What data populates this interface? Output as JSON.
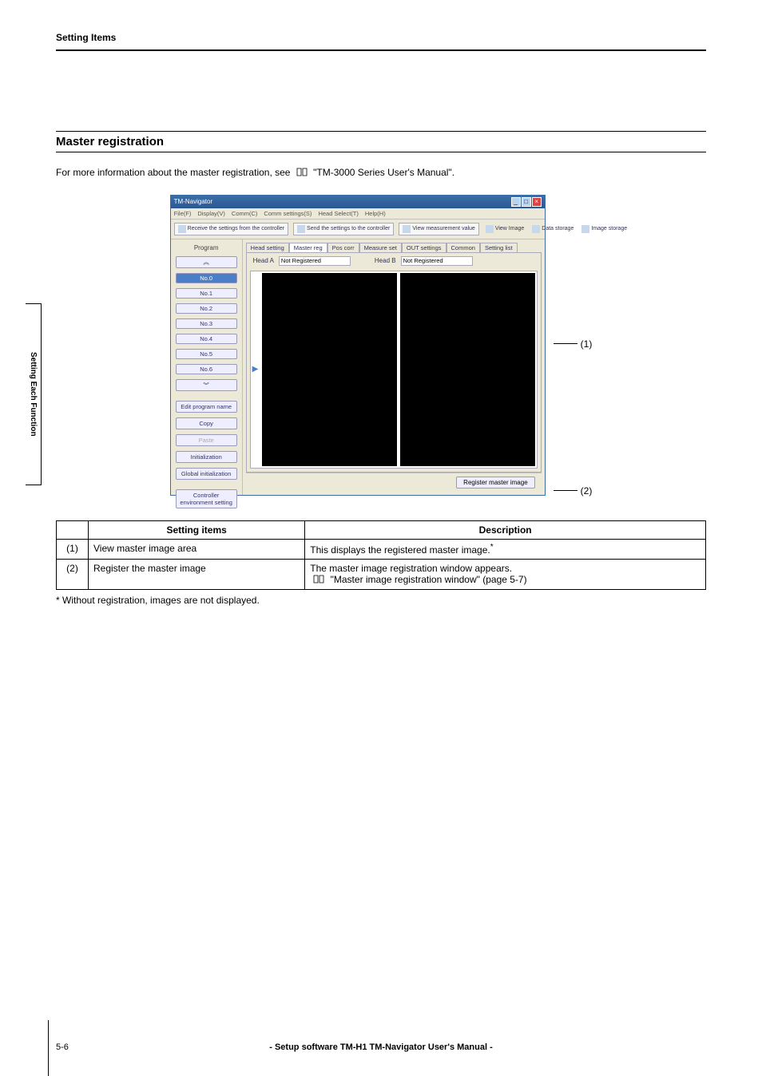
{
  "header": {
    "section": "Setting Items"
  },
  "side_tab": "Setting Each Function",
  "title": "Master registration",
  "intro_prefix": "For more information about the master registration, see ",
  "intro_suffix": " \"TM-3000 Series User's Manual\".",
  "app": {
    "title": "TM-Navigator",
    "menu": [
      "File(F)",
      "Display(V)",
      "Comm(C)",
      "Comm settings(S)",
      "Head Select(T)",
      "Help(H)"
    ],
    "toolbar": {
      "receive": "Receive the settings from the controller",
      "send": "Send the settings to the controller",
      "view_meas": "View measurement value",
      "view_image": "View Image",
      "data_storage": "Data storage",
      "image_storage": "Image storage"
    },
    "sidebar": {
      "program_label": "Program",
      "items": [
        "No.0",
        "No.1",
        "No.2",
        "No.3",
        "No.4",
        "No.5",
        "No.6"
      ],
      "edit_name": "Edit program name",
      "copy": "Copy",
      "paste": "Paste",
      "init": "Initialization",
      "ginit": "Global initialization",
      "ctrl_env": "Controller environment setting"
    },
    "tabs": [
      "Head setting",
      "Master reg",
      "Pos corr",
      "Measure set",
      "OUT settings",
      "Common",
      "Setting list"
    ],
    "active_tab": 1,
    "head_a_label": "Head A",
    "head_a_value": "Not Registered",
    "head_b_label": "Head B",
    "head_b_value": "Not Registered",
    "register_btn": "Register master image"
  },
  "callouts": {
    "one": "(1)",
    "two": "(2)"
  },
  "table": {
    "h1": "Setting items",
    "h2": "Description",
    "rows": [
      {
        "num": "(1)",
        "name": "View master image area",
        "desc": "This displays the registered master image.",
        "sup": "*"
      },
      {
        "num": "(2)",
        "name": "Register the master image",
        "desc_line1": "The master image registration window appears.",
        "desc_line2": " \"Master image registration window\" (page 5-7)"
      }
    ]
  },
  "footnote": "*   Without registration, images are not displayed.",
  "footer": {
    "page": "5-6",
    "center": "- Setup software TM-H1 TM-Navigator User's Manual -"
  }
}
